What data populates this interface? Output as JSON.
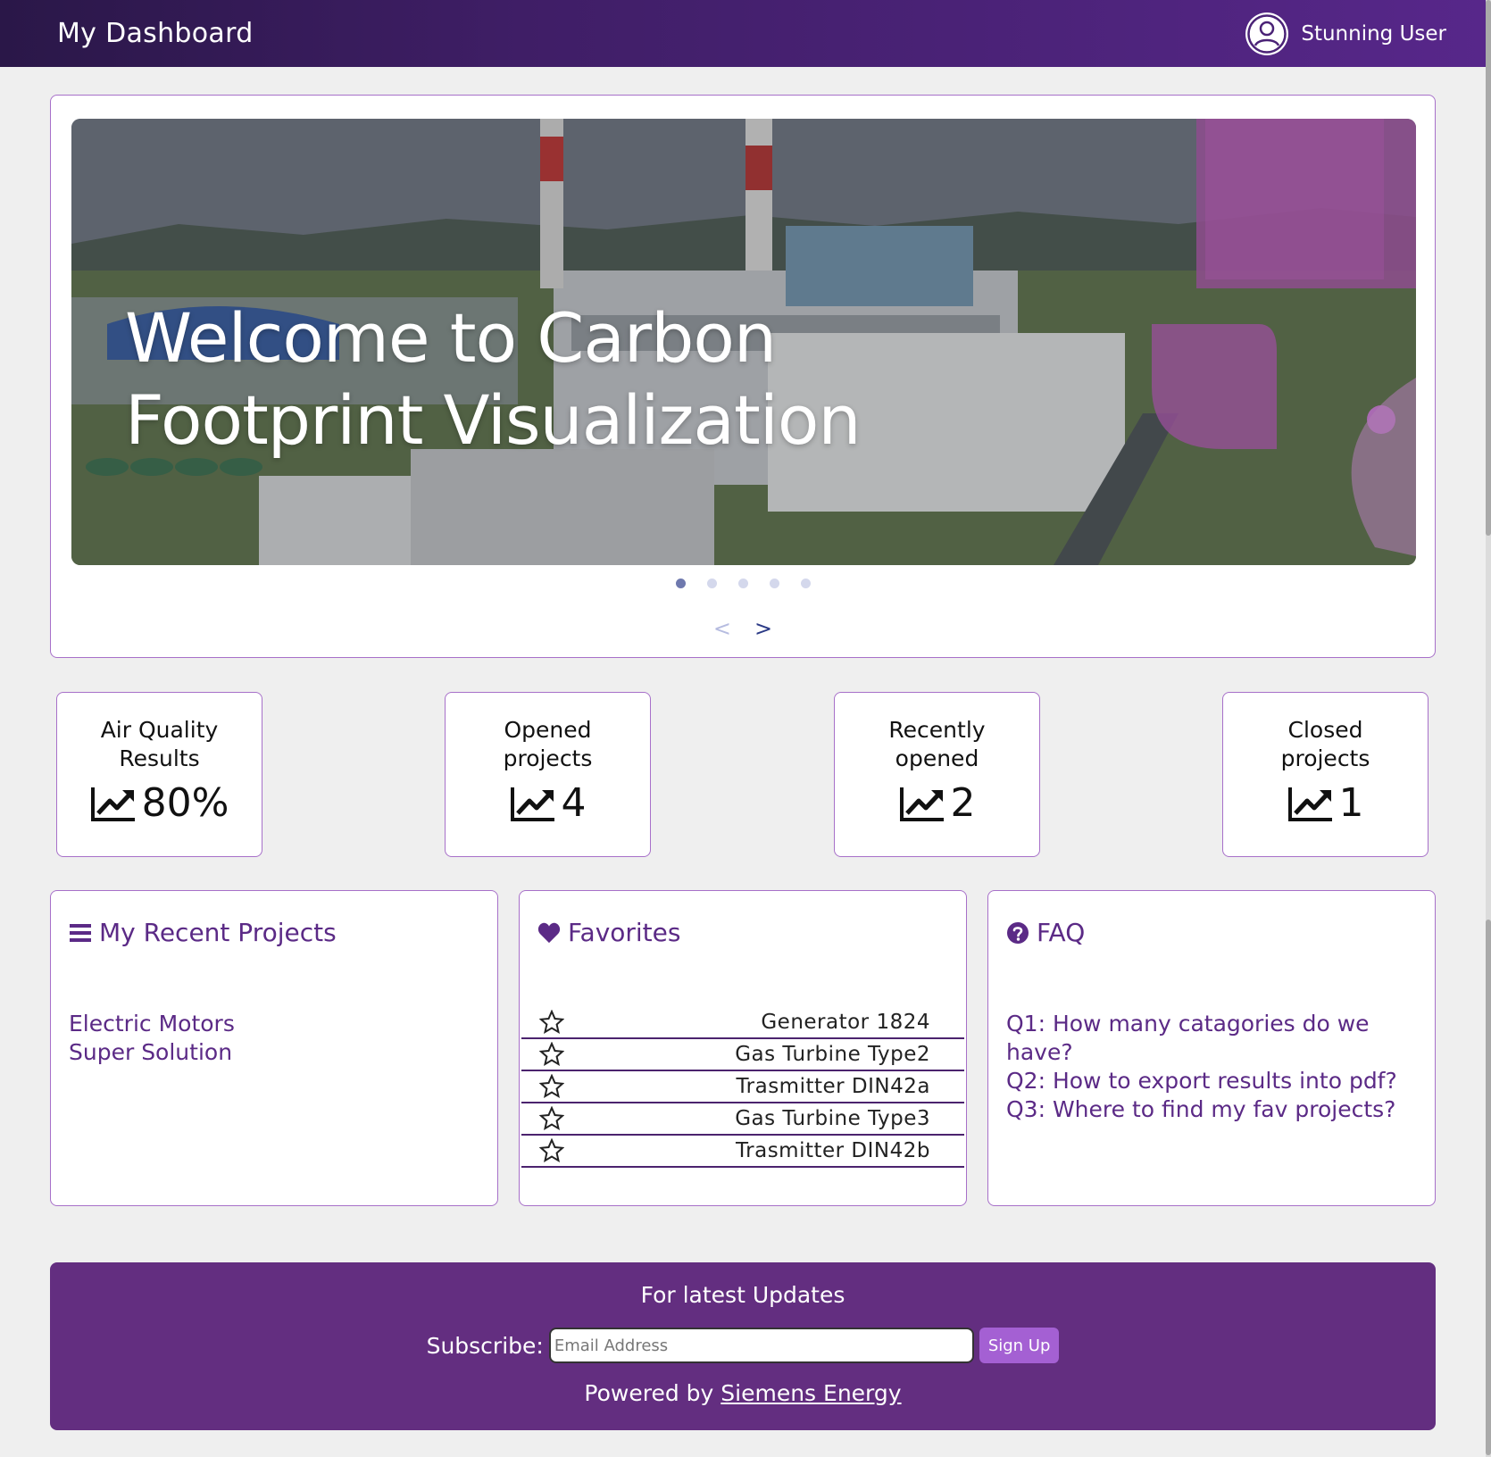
{
  "header": {
    "title": "My Dashboard",
    "user_name": "Stunning User"
  },
  "hero": {
    "title_line1": "Welcome to Carbon",
    "title_line2": "Footprint Visualization",
    "slide_count": 5,
    "active_slide": 1,
    "prev_label": "<",
    "next_label": ">"
  },
  "stats": [
    {
      "label_line1": "Air Quality",
      "label_line2": "Results",
      "value": "80%"
    },
    {
      "label_line1": "Opened",
      "label_line2": "projects",
      "value": "4"
    },
    {
      "label_line1": "Recently",
      "label_line2": "opened",
      "value": "2"
    },
    {
      "label_line1": "Closed",
      "label_line2": "projects",
      "value": "1"
    }
  ],
  "recent_projects": {
    "title": "My Recent Projects",
    "items": [
      "Electric Motors",
      "Super Solution"
    ]
  },
  "favorites": {
    "title": "Favorites",
    "items": [
      "Generator 1824",
      "Gas Turbine Type2",
      "Trasmitter DIN42a",
      "Gas Turbine Type3",
      "Trasmitter DIN42b"
    ]
  },
  "faq": {
    "title": "FAQ",
    "items": [
      "Q1: How many catagories do we have?",
      "Q2: How to export results into pdf?",
      "Q3: Where to find my fav projects?"
    ]
  },
  "footer": {
    "title": "For latest Updates",
    "subscribe_label": "Subscribe:",
    "email_placeholder": "Email Address",
    "signup_label": "Sign Up",
    "powered_prefix": "Powered by",
    "powered_link": "Siemens Energy"
  },
  "colors": {
    "brand": "#57278a",
    "accent": "#a460d3",
    "footer": "#632e80",
    "link": "#5b2a86",
    "card_border": "#a770c9"
  }
}
